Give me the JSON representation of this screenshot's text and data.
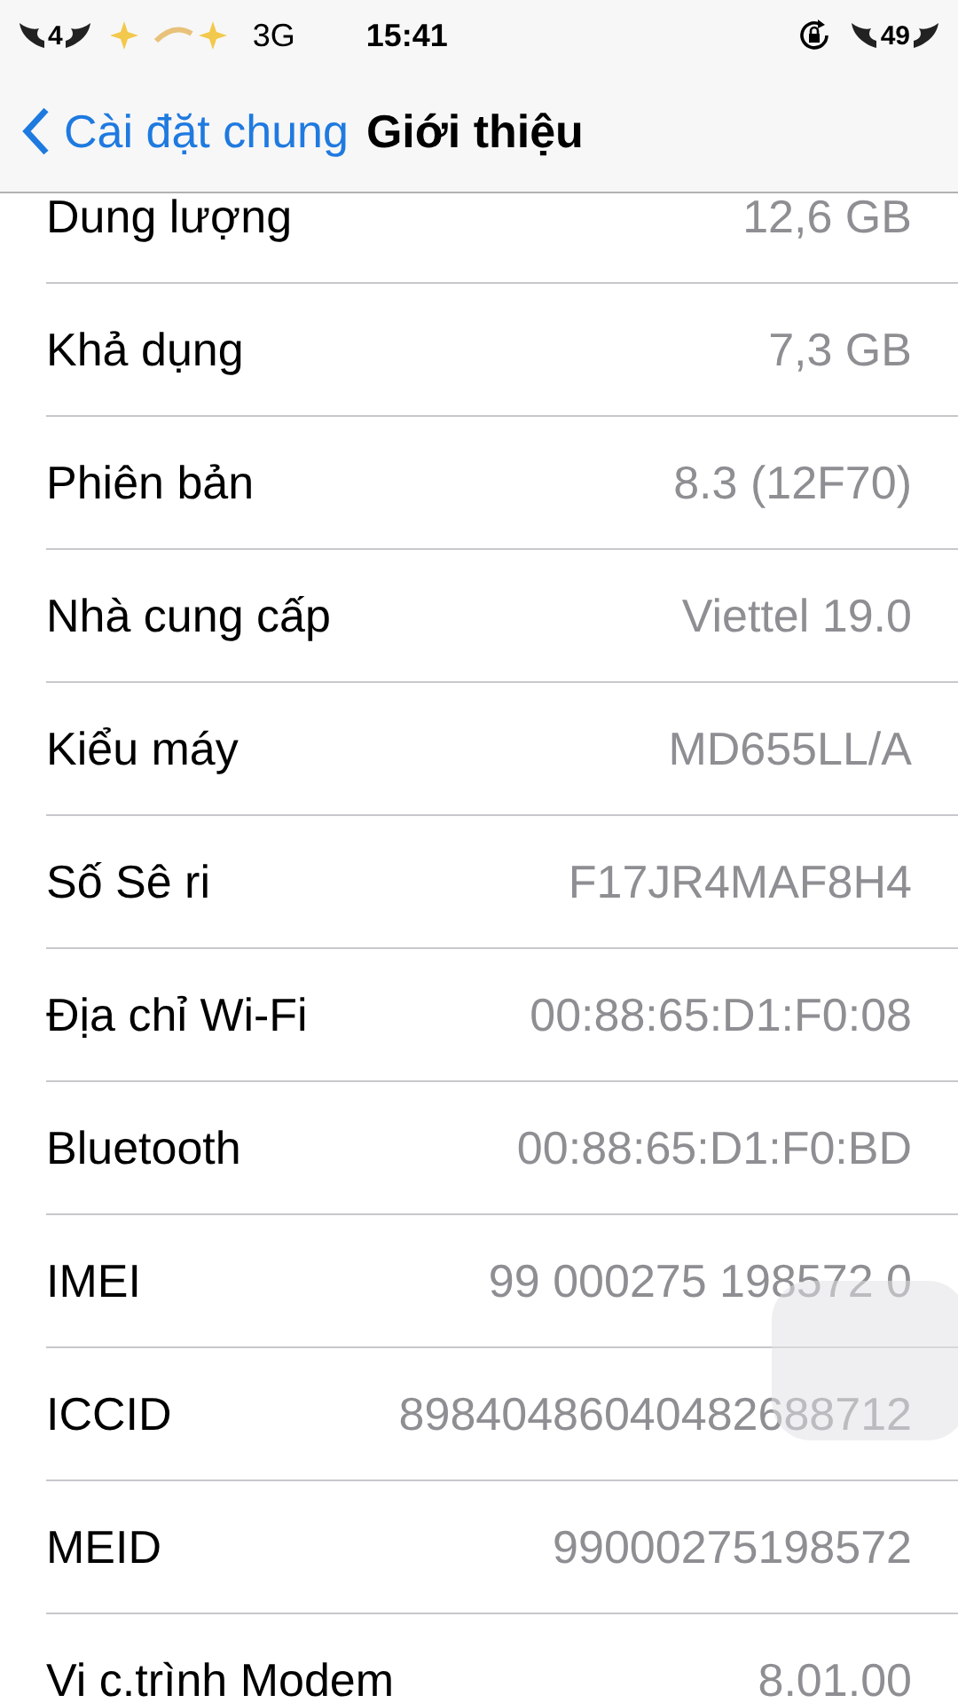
{
  "status_bar": {
    "carrier_badge": "4",
    "network": "3G",
    "time": "15:41",
    "battery_badge": "49"
  },
  "nav": {
    "back_label": "Cài đặt chung",
    "title": "Giới thiệu"
  },
  "rows": [
    {
      "label": "Dung lượng",
      "value": "12,6 GB"
    },
    {
      "label": "Khả dụng",
      "value": "7,3 GB"
    },
    {
      "label": "Phiên bản",
      "value": "8.3 (12F70)"
    },
    {
      "label": "Nhà cung cấp",
      "value": "Viettel 19.0"
    },
    {
      "label": "Kiểu máy",
      "value": "MD655LL/A"
    },
    {
      "label": "Số Sê ri",
      "value": "F17JR4MAF8H4"
    },
    {
      "label": "Địa chỉ Wi-Fi",
      "value": "00:88:65:D1:F0:08"
    },
    {
      "label": "Bluetooth",
      "value": "00:88:65:D1:F0:BD"
    },
    {
      "label": "IMEI",
      "value": "99 000275 198572 0"
    },
    {
      "label": "ICCID",
      "value": "89840486040482688712"
    },
    {
      "label": "MEID",
      "value": "99000275198572"
    },
    {
      "label": "Vi c.trình Modem",
      "value": "8.01.00"
    }
  ]
}
